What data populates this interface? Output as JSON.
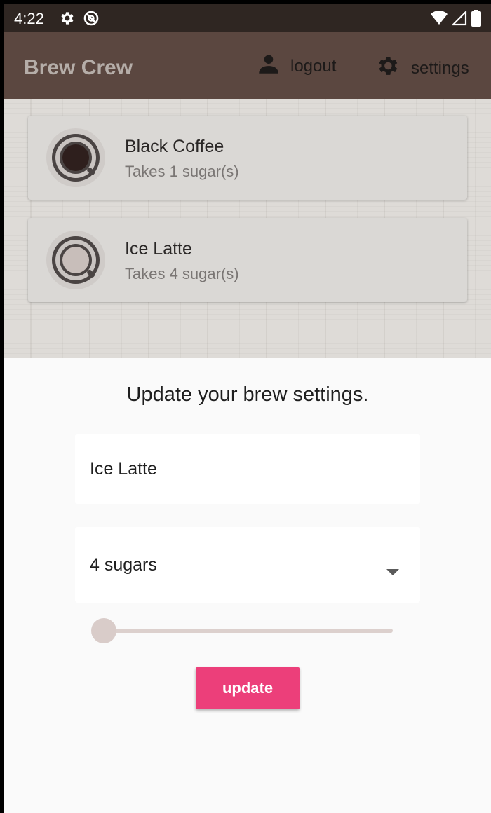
{
  "status_bar": {
    "time": "4:22",
    "left_icons": [
      "gear-icon",
      "no-sync-icon"
    ],
    "right_icons": [
      "wifi-icon",
      "signal-icon",
      "battery-icon"
    ]
  },
  "app_bar": {
    "title": "Brew Crew",
    "logout_label": "logout",
    "settings_label": "settings",
    "background_color": "#5b4740"
  },
  "brews": [
    {
      "name": "Black Coffee",
      "subtitle": "Takes 1 sugar(s)",
      "cup_color": "#2e1f1d"
    },
    {
      "name": "Ice Latte",
      "subtitle": "Takes 4 sugar(s)",
      "cup_color": "#c8beba"
    }
  ],
  "settings_sheet": {
    "title": "Update your brew settings.",
    "name_value": "Ice Latte",
    "sugars_selected": "4 sugars",
    "strength_slider_value": 0,
    "update_label": "update",
    "accent_color": "#ec3f7a"
  }
}
